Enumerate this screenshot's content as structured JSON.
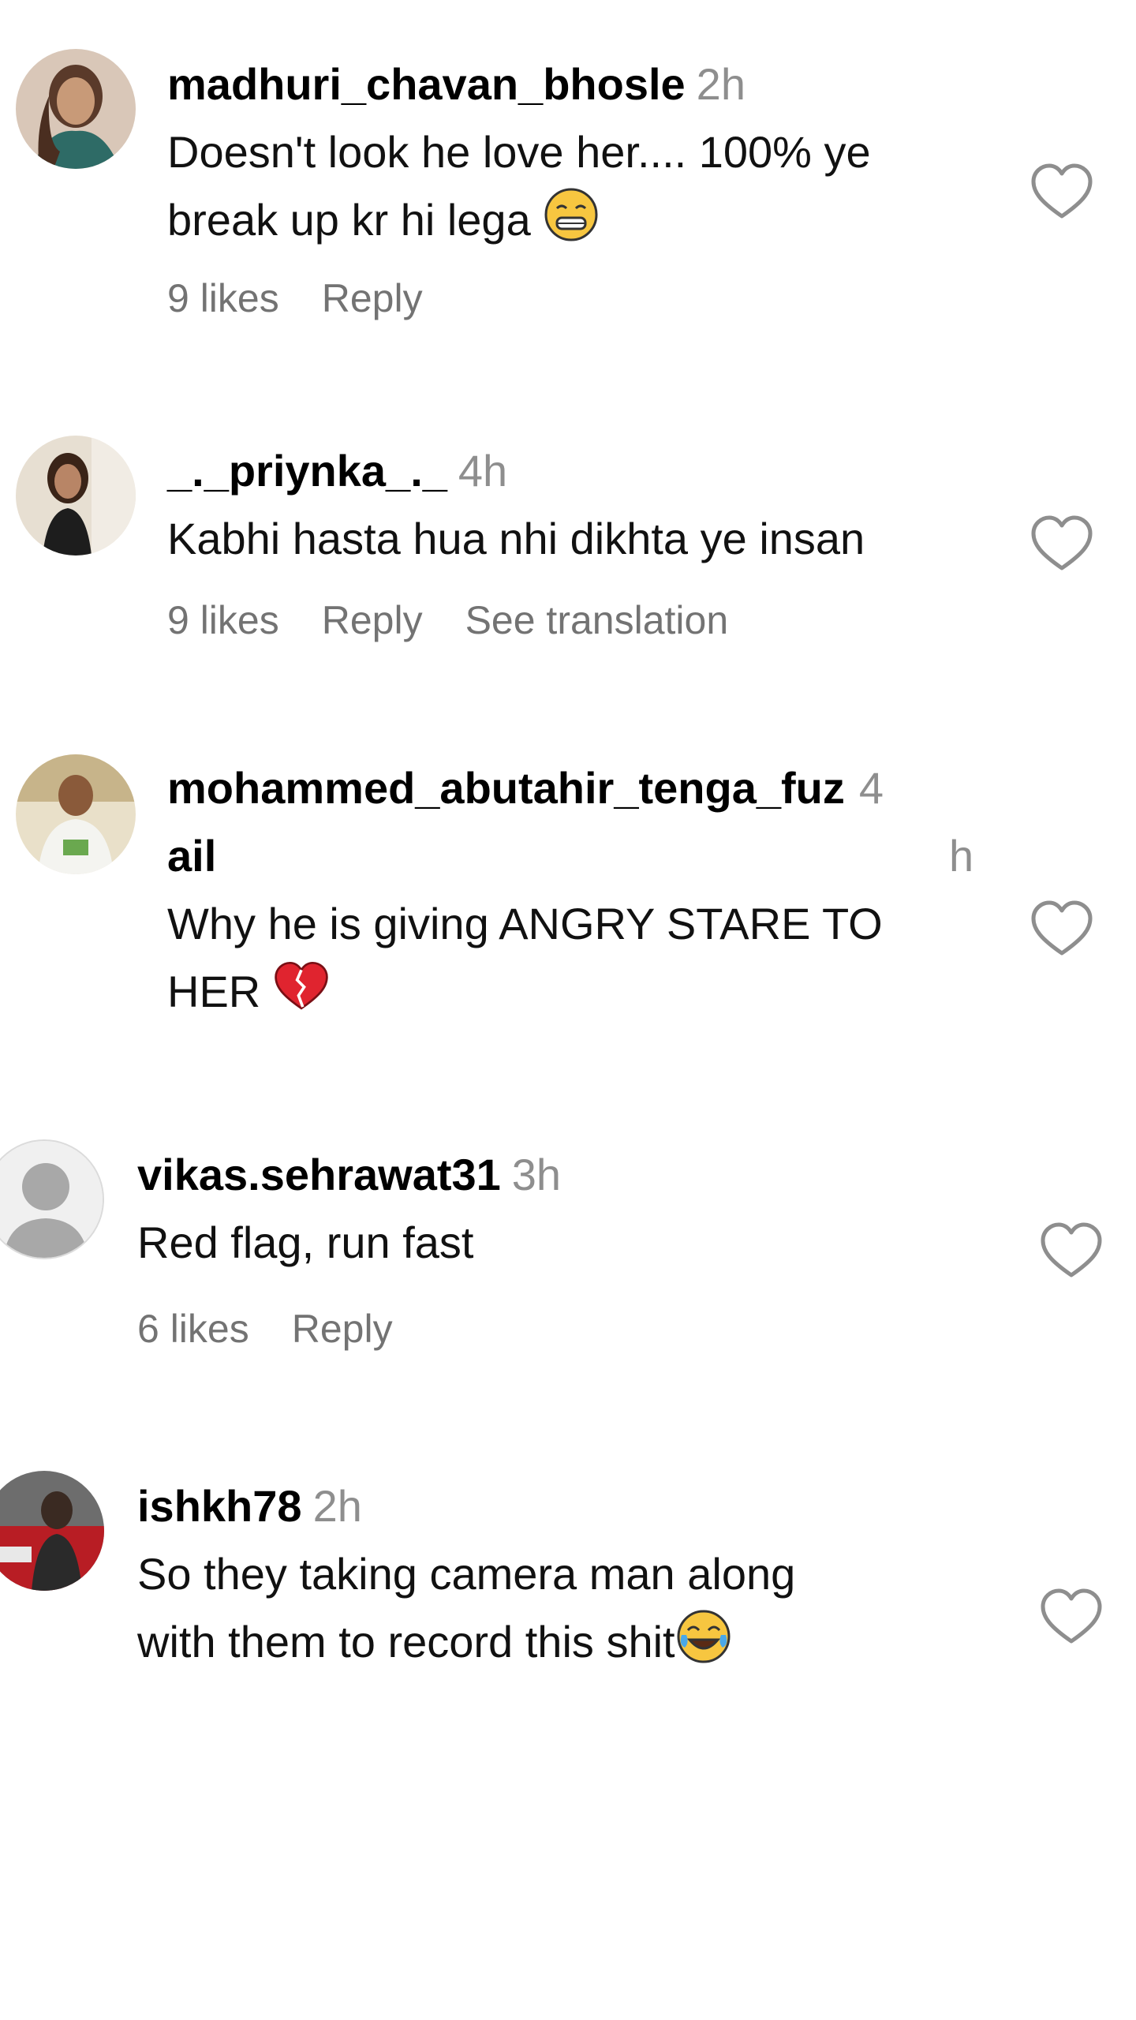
{
  "comments": [
    {
      "username": "madhuri_chavan_bhosle",
      "time": "2h",
      "text": "Doesn't look he love her.... 100% ye\nbreak up kr hi lega",
      "emoji": "grimace-laugh-emoji",
      "likes": "9 likes",
      "reply": "Reply",
      "avatar": "profile-photo-woman"
    },
    {
      "username": "_._priynka_._",
      "time": "4h",
      "text": "Kabhi hasta hua nhi dikhta ye insan",
      "likes": "9 likes",
      "reply": "Reply",
      "translation": "See translation",
      "avatar": "profile-photo-woman-dark"
    },
    {
      "username_line1": "mohammed_abutahir_tenga_fuz",
      "username_line2": "ail",
      "time_line1": "4",
      "time_line2": "h",
      "text": "Why he is giving ANGRY STARE TO\nHER",
      "emoji": "broken-heart-emoji",
      "avatar": "profile-photo-man"
    },
    {
      "username": "vikas.sehrawat31",
      "time": "3h",
      "text": "Red flag, run fast",
      "likes": "6 likes",
      "reply": "Reply",
      "avatar": "default-avatar"
    },
    {
      "username": "ishkh78",
      "time": "2h",
      "text": "So they taking camera man along\nwith them to record this shit",
      "emoji": "tears-of-joy-emoji",
      "avatar": "profile-photo-car"
    }
  ],
  "colors": {
    "primary_text": "#000000",
    "secondary_text": "#737373",
    "time_text": "#8e8e8e",
    "heart_stroke": "#8e8e8e",
    "background": "#ffffff"
  },
  "icons": {
    "like": "heart-outline-icon"
  }
}
